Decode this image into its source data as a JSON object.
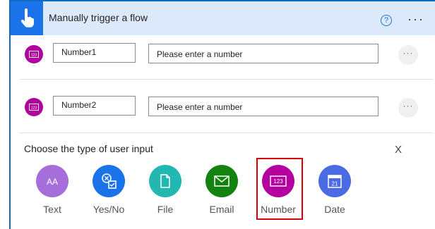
{
  "header": {
    "title": "Manually trigger a flow",
    "help_glyph": "?",
    "more_glyph": "···"
  },
  "rows": [
    {
      "name": "Number1",
      "placeholder": "Please enter a number",
      "more_glyph": "···"
    },
    {
      "name": "Number2",
      "placeholder": "Please enter a number",
      "more_glyph": "···"
    }
  ],
  "input_type": {
    "title": "Choose the type of user input",
    "close_glyph": "X",
    "options": [
      {
        "label": "Text",
        "color": "#a56edb"
      },
      {
        "label": "Yes/No",
        "color": "#1a73e8"
      },
      {
        "label": "File",
        "color": "#22b8b1"
      },
      {
        "label": "Email",
        "color": "#13820e"
      },
      {
        "label": "Number",
        "color": "#b4009e"
      },
      {
        "label": "Date",
        "color": "#4a6be4"
      }
    ],
    "selected": "Number",
    "number_glyph": "123",
    "date_glyph": "21",
    "text_glyph": "AA"
  },
  "colors": {
    "header_bg": "#dbe9fb",
    "accent": "#1a73e8",
    "number_icon": "#b4009e",
    "highlight": "#d60000"
  }
}
